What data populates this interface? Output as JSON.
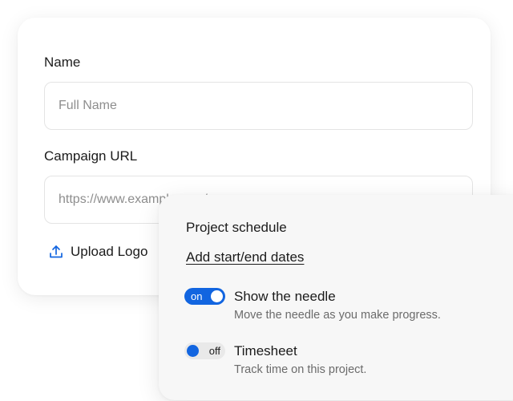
{
  "form": {
    "name_label": "Name",
    "name_placeholder": "Full Name",
    "url_label": "Campaign URL",
    "url_placeholder": "https://www.example.com/c",
    "upload_label": "Upload Logo",
    "upload_icon": "upload-icon"
  },
  "schedule": {
    "title": "Project schedule",
    "link": "Add start/end dates",
    "options": [
      {
        "toggle_text": "on",
        "enabled": true,
        "title": "Show the needle",
        "description": "Move the needle as you make progress."
      },
      {
        "toggle_text": "off",
        "enabled": false,
        "title": "Timesheet",
        "description": "Track time on this project."
      }
    ]
  },
  "colors": {
    "accent": "#1265e0",
    "card_back": "#ffffff",
    "card_front": "#f7f7f7"
  }
}
